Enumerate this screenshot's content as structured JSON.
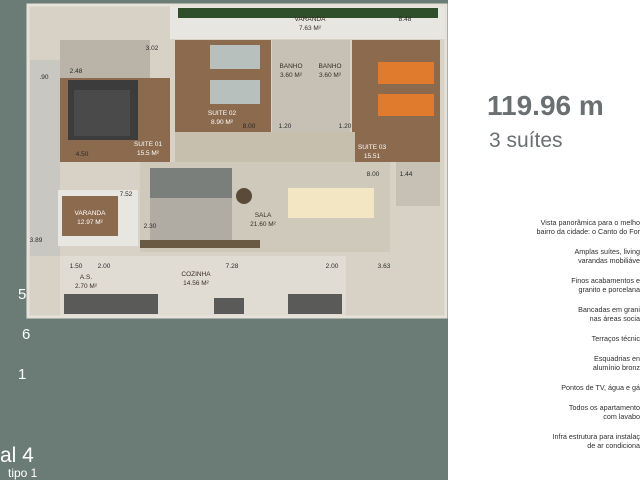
{
  "rooms": {
    "varanda_top": {
      "name": "VARANDA",
      "area": "7.63 M²"
    },
    "suite_master": {
      "name": "SUITE 01",
      "area": "15.5 M²"
    },
    "suite_02": {
      "name": "SUITE 02",
      "area": "8.90 M²"
    },
    "suite_03": {
      "name": "SUITE 03",
      "area": "15.51"
    },
    "banho_1": {
      "name": "BANHO",
      "area": "3.60 M²"
    },
    "banho_2": {
      "name": "BANHO",
      "area": "3.60 M²"
    },
    "varanda_small": {
      "name": "VARANDA",
      "area": "12.97 M²"
    },
    "sala": {
      "name": "SALA",
      "area": "21.60 M²"
    },
    "as": {
      "name": "A.S.",
      "area": "2.70 M²"
    },
    "cozinha": {
      "name": "COZINHA",
      "area": "14.56 M²"
    }
  },
  "dimensions": {
    "d848": "8.48",
    "d90": ".90",
    "d248": "2.48",
    "d302": "3.02",
    "d450": "4.50",
    "d800a": "8.00",
    "d120a": "1.20",
    "d120b": "1.20",
    "d800b": "8.00",
    "d144": "1.44",
    "d752": "7.52",
    "d230": "2.30",
    "d389": "3.89",
    "d150": "1.50",
    "d200a": "2.00",
    "d728": "7.28",
    "d200b": "2.00",
    "d363": "3.63"
  },
  "summary": {
    "area": "119.96 m",
    "suites": "3 suítes"
  },
  "features": [
    [
      "Vista panorâmica para o melho",
      "bairro da cidade: o Canto do For"
    ],
    [
      "Amplas suítes, living",
      "varandas mobiliáve"
    ],
    [
      "Finos acabamentos e",
      "granito e porcelana"
    ],
    [
      "Bancadas em grani",
      "nas áreas socia"
    ],
    [
      "Terraços técnic"
    ],
    [
      "Esquadrias en",
      "alumínio bronz"
    ],
    [
      "Pontos de TV, água e gá"
    ],
    [
      "Todos os apartamento",
      "com lavabo"
    ],
    [
      "Infra estrutura para instalaç",
      "de ar condiciona"
    ]
  ],
  "building": {
    "numbers": [
      "5",
      "6",
      "1"
    ],
    "final": "al 4",
    "tipo": "tipo 1"
  },
  "colors": {
    "panel": "#6b7c76",
    "wood": "#8b6a4e",
    "wall": "#d8d2c6",
    "accent_bed": "#e07a2c",
    "dark": "#3c3c3c"
  }
}
